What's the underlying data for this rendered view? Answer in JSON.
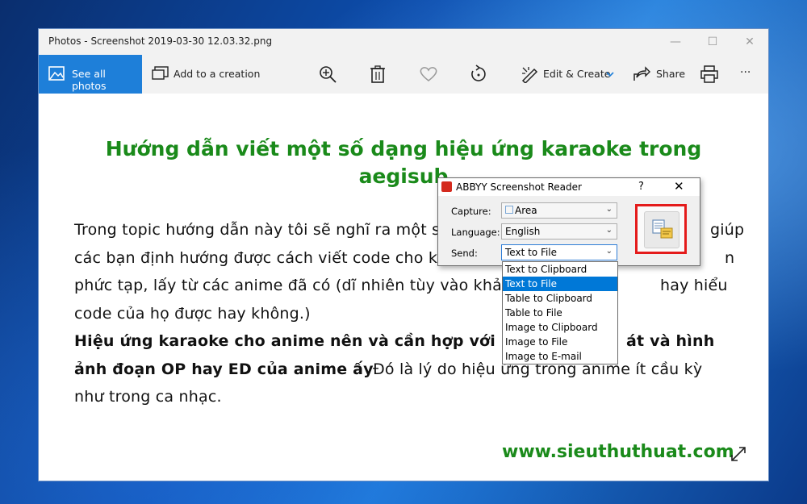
{
  "window": {
    "title": "Photos - Screenshot 2019-03-30 12.03.32.png",
    "controls": [
      "—",
      "☐",
      "✕"
    ]
  },
  "toolbar": {
    "see_all_photos": "See all photos",
    "add_to_creation": "Add to a creation",
    "edit_create": "Edit & Create",
    "share": "Share",
    "more": "···"
  },
  "document": {
    "title_line1": "Hướng dẫn viết một số dạng hiệu ứng karaoke trong",
    "title_line2": "aegisub",
    "lines": [
      "Trong topic hướng dẫn này tôi sẽ nghĩ ra một số",
      "các bạn định hướng được cách viết code cho ka",
      "phức tạp, lấy từ các anime đã có (dĩ nhiên tùy vào khả n",
      "code của họ được hay không.)",
      "Hiệu ứng karaoke cho anime nên và cần hợp với n",
      "ảnh đoạn OP hay ED của anime ấy",
      "như trong ca nhạc."
    ],
    "line1_tail": "giúp",
    "line2_tail": "n",
    "line3_tail": "hay hiểu",
    "line5_tail": "át và hình",
    "line6_tail": "Đó là lý do hiệu ứng trong anime ít cầu kỳ",
    "website": "www.sieuthuthuat.com"
  },
  "abbyy": {
    "title": "ABBYY Screenshot Reader",
    "help": "?",
    "close": "✕",
    "capture_label": "Capture:",
    "capture_value": "Area",
    "language_label": "Language:",
    "language_value": "English",
    "send_label": "Send:",
    "send_value": "Text to File",
    "send_options": [
      "Text to Clipboard",
      "Text to File",
      "Table to Clipboard",
      "Table to File",
      "Image to Clipboard",
      "Image to File",
      "Image to E-mail"
    ],
    "selected_index": 1
  }
}
